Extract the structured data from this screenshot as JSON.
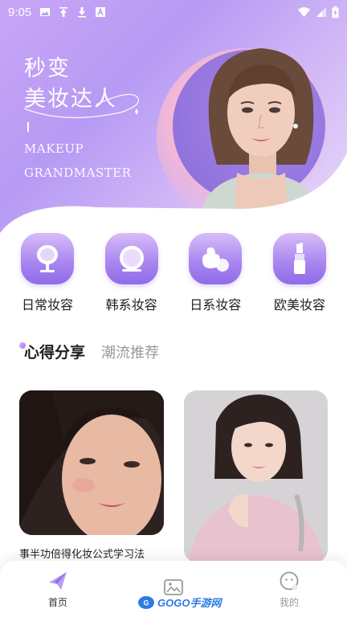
{
  "status_bar": {
    "time": "9:05",
    "left_icons": [
      "image-icon",
      "upload-icon",
      "download-icon",
      "a-icon"
    ],
    "right_icons": [
      "wifi-icon",
      "signal-icon",
      "battery-icon"
    ]
  },
  "banner": {
    "title_line1": "秒变",
    "title_line2": "美妆达人",
    "subtitle_line1": "MAKEUP",
    "subtitle_line2": "GRANDMASTER"
  },
  "categories": [
    {
      "label": "日常妆容",
      "icon": "mirror-icon"
    },
    {
      "label": "韩系妆容",
      "icon": "compact-mirror-icon"
    },
    {
      "label": "日系妆容",
      "icon": "powder-puff-icon"
    },
    {
      "label": "欧美妆容",
      "icon": "lipstick-icon"
    }
  ],
  "tabs": {
    "active": "心得分享",
    "inactive": "潮流推荐"
  },
  "cards": [
    {
      "caption": "事半功倍得化妆公式学习法"
    },
    {
      "caption": ""
    }
  ],
  "bottom_nav": {
    "items": [
      {
        "label": "首页",
        "icon": "home-plane-icon",
        "active": true
      },
      {
        "label": "",
        "icon": "gallery-icon",
        "active": false
      },
      {
        "label": "我的",
        "icon": "profile-face-icon",
        "active": false
      }
    ]
  },
  "watermark": {
    "text": "GOGO手游网"
  },
  "colors": {
    "accent": "#9b77ea",
    "banner_start": "#c9a6f6",
    "banner_end": "#e8dcf9"
  }
}
